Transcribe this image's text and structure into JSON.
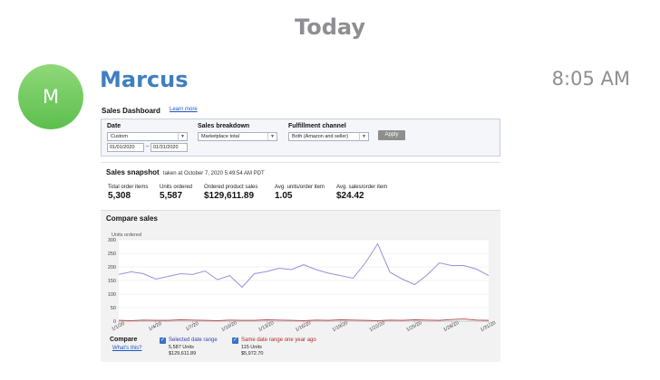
{
  "day_header": "Today",
  "message": {
    "avatar_initial": "M",
    "sender": "Marcus",
    "time": "8:05 AM"
  },
  "dashboard": {
    "title": "Sales Dashboard",
    "learn_more": "Learn more",
    "filters": {
      "date_label": "Date",
      "date_select": "Custom",
      "date_from": "01/01/2020",
      "date_sep": "–",
      "date_to": "01/31/2020",
      "breakdown_label": "Sales breakdown",
      "breakdown_select": "Marketplace total",
      "fulfillment_label": "Fulfillment channel",
      "fulfillment_select": "Both (Amazon and seller)",
      "apply_label": "Apply"
    },
    "snapshot": {
      "title": "Sales snapshot",
      "subtitle": "taken at October 7, 2020 5:49:54 AM PDT",
      "metrics": [
        {
          "label": "Total order items",
          "value": "5,308"
        },
        {
          "label": "Units ordered",
          "value": "5,587"
        },
        {
          "label": "Ordered product sales",
          "value": "$129,611.89"
        },
        {
          "label": "Avg. units/order item",
          "value": "1.05"
        },
        {
          "label": "Avg. sales/order item",
          "value": "$24.42"
        }
      ]
    },
    "compare": {
      "title": "Compare sales",
      "legend_title": "Compare",
      "whats_this": "What's this?",
      "selected_label": "Selected date range",
      "selected_units": "5,587 Units",
      "selected_sales": "$129,611.89",
      "prior_label": "Same date range one year ago",
      "prior_units": "115 Units",
      "prior_sales": "$5,972.70",
      "check_glyph": "✓"
    }
  },
  "chart_data": {
    "type": "line",
    "ylabel": "Units ordered",
    "ylim": [
      0,
      300
    ],
    "yticks": [
      0,
      50,
      100,
      150,
      200,
      250,
      300
    ],
    "x": [
      "1/1/20",
      "1/2/20",
      "1/3/20",
      "1/4/20",
      "1/5/20",
      "1/6/20",
      "1/7/20",
      "1/8/20",
      "1/9/20",
      "1/10/20",
      "1/11/20",
      "1/12/20",
      "1/13/20",
      "1/14/20",
      "1/15/20",
      "1/16/20",
      "1/17/20",
      "1/18/20",
      "1/19/20",
      "1/20/20",
      "1/21/20",
      "1/22/20",
      "1/23/20",
      "1/24/20",
      "1/25/20",
      "1/26/20",
      "1/27/20",
      "1/28/20",
      "1/29/20",
      "1/30/20",
      "1/31/20"
    ],
    "xtick_labels": [
      "1/1/20",
      "1/4/20",
      "1/7/20",
      "1/10/20",
      "1/13/20",
      "1/16/20",
      "1/19/20",
      "1/22/20",
      "1/25/20",
      "1/28/20",
      "1/31/20"
    ],
    "series": [
      {
        "name": "Selected date range",
        "color": "#9b8fd9",
        "values": [
          172,
          182,
          175,
          155,
          165,
          175,
          172,
          185,
          153,
          168,
          125,
          175,
          183,
          195,
          190,
          208,
          190,
          177,
          168,
          158,
          215,
          285,
          180,
          155,
          135,
          170,
          215,
          205,
          205,
          192,
          168
        ]
      },
      {
        "name": "Same date range one year ago",
        "color": "#b84040",
        "values": [
          3,
          2,
          4,
          3,
          3,
          5,
          4,
          3,
          2,
          4,
          3,
          3,
          5,
          4,
          3,
          2,
          4,
          3,
          5,
          4,
          3,
          2,
          4,
          3,
          5,
          4,
          3,
          6,
          8,
          4,
          3
        ]
      }
    ],
    "grid": true,
    "legend_position": "bottom-left"
  },
  "colors": {
    "sender_blue": "#3f7fc0",
    "avatar_green": "#5cbf4e",
    "link_blue": "#1a55c4",
    "selected_series": "#9b8fd9",
    "prior_series": "#b84040"
  }
}
